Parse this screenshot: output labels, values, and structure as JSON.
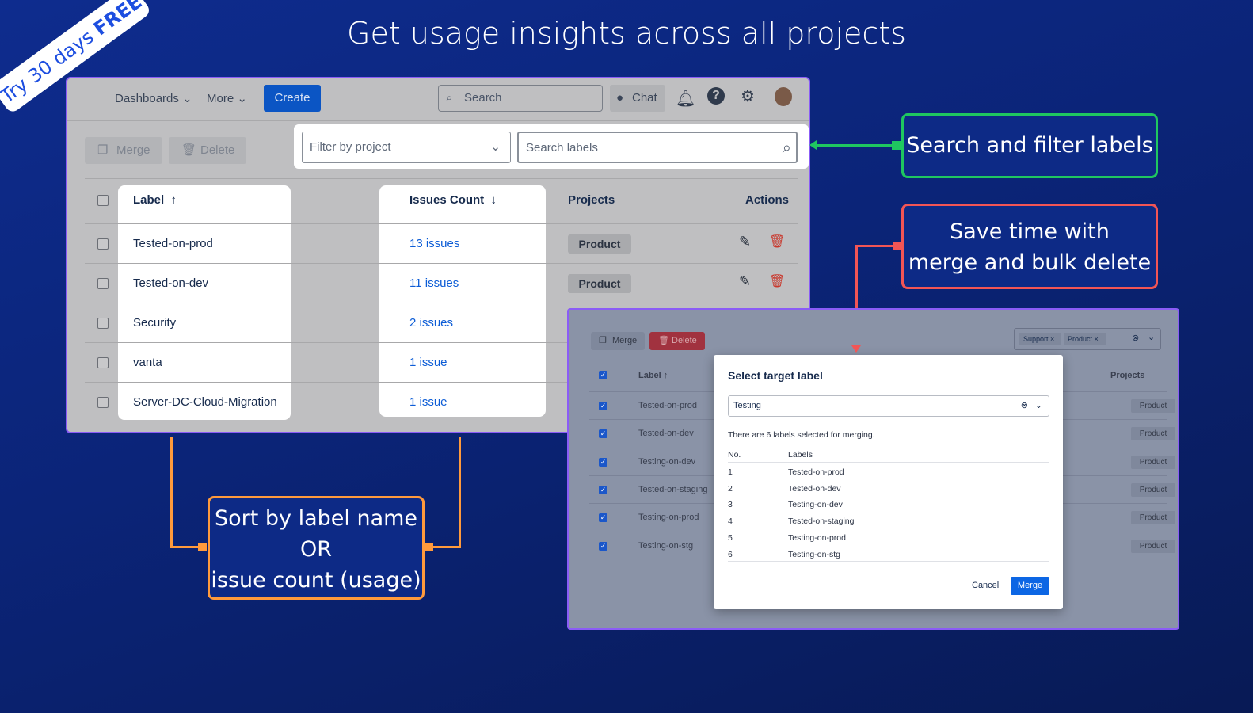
{
  "headline": "Get usage insights across all projects",
  "ribbon": {
    "prefix": "Try 30 days ",
    "bold": "FREE"
  },
  "topbar": {
    "dashboards": "Dashboards",
    "more": "More",
    "create": "Create",
    "search_placeholder": "Search",
    "chat": "Chat"
  },
  "toolbar": {
    "merge": "Merge",
    "delete": "Delete",
    "filter_placeholder": "Filter by project",
    "search_labels_placeholder": "Search labels"
  },
  "table": {
    "headers": {
      "label": "Label",
      "issues": "Issues Count",
      "projects": "Projects",
      "actions": "Actions"
    },
    "rows": [
      {
        "label": "Tested-on-prod",
        "issues": "13 issues",
        "project": "Product"
      },
      {
        "label": "Tested-on-dev",
        "issues": "11 issues",
        "project": "Product"
      },
      {
        "label": "Security",
        "issues": "2 issues",
        "project": ""
      },
      {
        "label": "vanta",
        "issues": "1 issue",
        "project": ""
      },
      {
        "label": "Server-DC-Cloud-Migration",
        "issues": "1 issue",
        "project": ""
      }
    ]
  },
  "callouts": {
    "search": "Search and filter labels",
    "merge": [
      "Save time with",
      "merge and bulk delete"
    ],
    "sort": [
      "Sort by label name",
      "OR",
      "issue count (usage)"
    ]
  },
  "panel2": {
    "merge": "Merge",
    "delete": "Delete",
    "filter_tags": [
      "Support",
      "Product"
    ],
    "headers": {
      "label": "Label",
      "projects": "Projects"
    },
    "rows": [
      {
        "label": "Tested-on-prod",
        "project": "Product"
      },
      {
        "label": "Tested-on-dev",
        "project": "Product"
      },
      {
        "label": "Testing-on-dev",
        "project": "Product"
      },
      {
        "label": "Tested-on-staging",
        "project": "Product"
      },
      {
        "label": "Testing-on-prod",
        "project": "Product"
      },
      {
        "label": "Testing-on-stg",
        "project": "Product"
      }
    ]
  },
  "modal": {
    "title": "Select target label",
    "value": "Testing",
    "info": "There are 6 labels selected for merging.",
    "col_no": "No.",
    "col_labels": "Labels",
    "items": [
      {
        "no": "1",
        "label": "Tested-on-prod"
      },
      {
        "no": "2",
        "label": "Tested-on-dev"
      },
      {
        "no": "3",
        "label": "Testing-on-dev"
      },
      {
        "no": "4",
        "label": "Tested-on-staging"
      },
      {
        "no": "5",
        "label": "Testing-on-prod"
      },
      {
        "no": "6",
        "label": "Testing-on-stg"
      }
    ],
    "cancel": "Cancel",
    "merge": "Merge"
  },
  "colors": {
    "green": "#1fc760",
    "red": "#f25555",
    "orange": "#ff9a3c",
    "purple": "#8b5cf6",
    "blue": "#0c5cd6"
  }
}
